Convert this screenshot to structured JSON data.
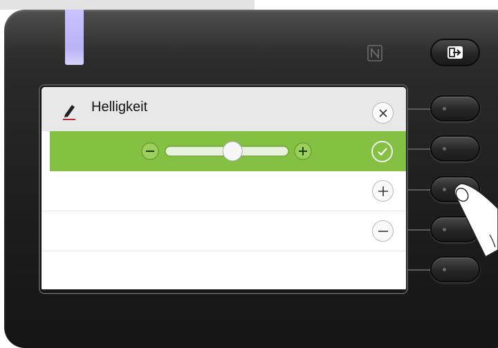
{
  "screen": {
    "title": "Helligkeit",
    "title_icon": "pencil-icon",
    "brightness_level": 0.55
  },
  "actions": {
    "close_icon": "close-icon",
    "confirm_icon": "check-icon",
    "increase_icon": "plus-icon",
    "decrease_icon": "minus-icon"
  },
  "hardware": {
    "logout_icon": "logout-arrow-icon",
    "nfc_icon": "nfc-icon"
  },
  "colors": {
    "accent_green": "#84c142",
    "led": "#c9c4ff",
    "header_bg": "#e8e8e8"
  }
}
